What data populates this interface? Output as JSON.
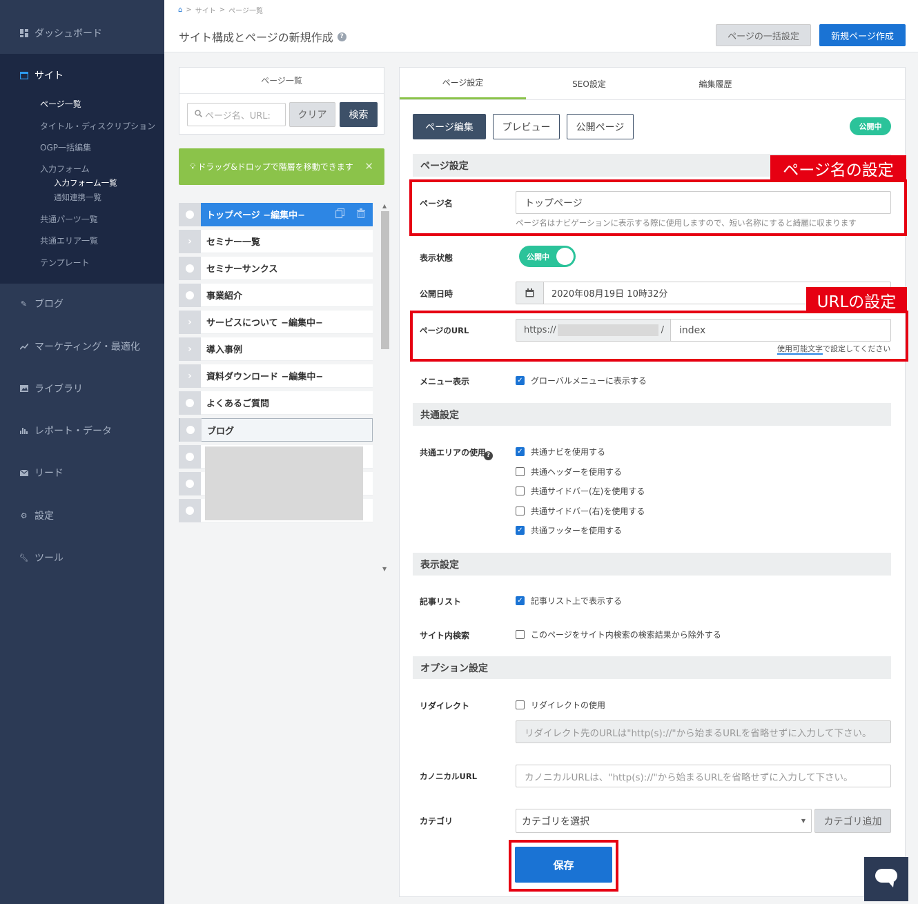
{
  "sidebar": {
    "dashboard": "ダッシュボード",
    "site": "サイト",
    "site_sub": {
      "page_list": "ページ一覧",
      "title_desc": "タイトル・ディスクリプション",
      "ogp": "OGP一括編集",
      "input_form": "入力フォーム",
      "input_form_list": "入力フォーム一覧",
      "notify": "通知連携一覧",
      "parts": "共通パーツ一覧",
      "area": "共通エリア一覧",
      "template": "テンプレート"
    },
    "blog": "ブログ",
    "marketing": "マーケティング・最適化",
    "library": "ライブラリ",
    "report": "レポート・データ",
    "lead": "リード",
    "settings": "設定",
    "tools": "ツール"
  },
  "header": {
    "breadcrumb": [
      "サイト",
      "ページ一覧"
    ],
    "title": "サイト構成とページの新規作成",
    "bulk_button": "ページの一括設定",
    "new_button": "新規ページ作成"
  },
  "page_list": {
    "title": "ページ一覧",
    "search_placeholder": "ページ名、URL:",
    "clear": "クリア",
    "search": "検索",
    "notice": "ドラッグ&ドロップで階層を移動できます",
    "items": [
      {
        "label": "トップページ −編集中−",
        "kind": "dot"
      },
      {
        "label": "セミナー一覧",
        "kind": "chevron"
      },
      {
        "label": "セミナーサンクス",
        "kind": "dot"
      },
      {
        "label": "事業紹介",
        "kind": "dot"
      },
      {
        "label": "サービスについて −編集中−",
        "kind": "chevron"
      },
      {
        "label": "導入事例",
        "kind": "chevron"
      },
      {
        "label": "資料ダウンロード −編集中−",
        "kind": "chevron"
      },
      {
        "label": "よくあるご質問",
        "kind": "dot"
      },
      {
        "label": "ブログ",
        "kind": "dot"
      }
    ]
  },
  "tabs": [
    "ページ設定",
    "SEO設定",
    "編集履歴"
  ],
  "actions": {
    "edit": "ページ編集",
    "preview": "プレビュー",
    "public_page": "公開ページ",
    "status_badge": "公開中"
  },
  "page_settings": {
    "section": "ページ設定",
    "name_label": "ページ名",
    "name_value": "トップページ",
    "name_hint": "ページ名はナビゲーションに表示する際に使用しますので、短い名称にすると綺麗に収まります",
    "display_label": "表示状態",
    "display_toggle": "公開中",
    "date_label": "公開日時",
    "date_value": "2020年08月19日 10時32分",
    "url_label": "ページのURL",
    "url_prefix": "https://",
    "url_sep": "/",
    "url_value": "index",
    "url_hint_link": "使用可能文字",
    "url_hint_rest": "で設定してください",
    "menu_label": "メニュー表示",
    "menu_option": "グローバルメニューに表示する",
    "menu_checked": true
  },
  "annotations": {
    "page_name": "ページ名の設定",
    "url": "URLの設定"
  },
  "common_settings": {
    "section": "共通設定",
    "label": "共通エリアの使用",
    "options": [
      {
        "label": "共通ナビを使用する",
        "checked": true
      },
      {
        "label": "共通ヘッダーを使用する",
        "checked": false
      },
      {
        "label": "共通サイドバー(左)を使用する",
        "checked": false
      },
      {
        "label": "共通サイドバー(右)を使用する",
        "checked": false
      },
      {
        "label": "共通フッターを使用する",
        "checked": true
      }
    ]
  },
  "display_settings": {
    "section": "表示設定",
    "article_label": "記事リスト",
    "article_option": "記事リスト上で表示する",
    "article_checked": true,
    "search_label": "サイト内検索",
    "search_option": "このページをサイト内検索の検索結果から除外する",
    "search_checked": false
  },
  "option_settings": {
    "section": "オプション設定",
    "redirect_label": "リダイレクト",
    "redirect_option": "リダイレクトの使用",
    "redirect_checked": false,
    "redirect_placeholder": "リダイレクト先のURLは\"http(s)://\"から始まるURLを省略せずに入力して下さい。",
    "canonical_label": "カノニカルURL",
    "canonical_placeholder": "カノニカルURLは、\"http(s)://\"から始まるURLを省略せずに入力して下さい。",
    "category_label": "カテゴリ",
    "category_value": "カテゴリを選択",
    "category_add": "カテゴリ追加"
  },
  "save": "保存",
  "colors": {
    "sidebar": "#2c3a55",
    "sidebar_active": "#1c2843",
    "primary": "#1a73d4",
    "dark_button": "#3d5068",
    "green": "#8bc34a",
    "teal": "#2bc39a",
    "annotation_red": "#e60012"
  },
  "icons": [
    "home-icon",
    "grid-icon",
    "window-icon",
    "pencil-icon",
    "trend-icon",
    "image-icon",
    "bar-chart-icon",
    "mail-icon",
    "gear-icon",
    "wrench-icon",
    "search-icon",
    "bulb-icon",
    "copy-icon",
    "trash-icon",
    "calendar-icon",
    "chat-icon"
  ]
}
